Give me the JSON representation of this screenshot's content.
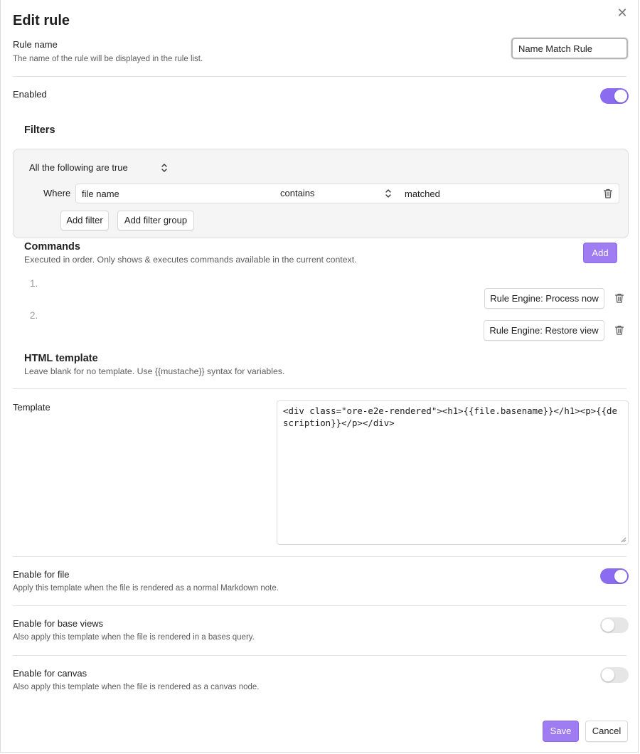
{
  "dialog": {
    "title": "Edit rule",
    "close_glyph": "✕"
  },
  "rule_name": {
    "label": "Rule name",
    "description": "The name of the rule will be displayed in the rule list.",
    "value": "Name Match Rule"
  },
  "enabled": {
    "label": "Enabled",
    "state": true
  },
  "filters": {
    "heading": "Filters",
    "conjunction": "All the following are true",
    "row": {
      "where_label": "Where",
      "property": "file name",
      "operator": "contains",
      "value": "matched"
    },
    "add_filter_label": "Add filter",
    "add_filter_group_label": "Add filter group"
  },
  "commands": {
    "heading": "Commands",
    "description": "Executed in order. Only shows & executes commands available in the current context.",
    "add_label": "Add",
    "items": [
      {
        "index": "1.",
        "label": "Rule Engine: Process now"
      },
      {
        "index": "2.",
        "label": "Rule Engine: Restore view"
      }
    ]
  },
  "html_template": {
    "heading": "HTML template",
    "description": "Leave blank for no template. Use {{mustache}} syntax for variables.",
    "template_label": "Template",
    "template_value": "<div class=\"ore-e2e-rendered\"><h1>{{file.basename}}</h1><p>{{description}}</p></div>"
  },
  "enable_for_file": {
    "label": "Enable for file",
    "description": "Apply this template when the file is rendered as a normal Markdown note.",
    "state": true
  },
  "enable_for_base_views": {
    "label": "Enable for base views",
    "description": "Also apply this template when the file is rendered in a bases query.",
    "state": false
  },
  "enable_for_canvas": {
    "label": "Enable for canvas",
    "description": "Also apply this template when the file is rendered as a canvas node.",
    "state": false
  },
  "footer": {
    "save_label": "Save",
    "cancel_label": "Cancel"
  },
  "colors": {
    "accent": "#8b6cf0",
    "accent_button": "#9f7cf2",
    "toggle_off": "#e6e6e6"
  },
  "icons": [
    "close-icon",
    "chevron-updown-icon",
    "trash-icon",
    "resize-handle-icon"
  ]
}
